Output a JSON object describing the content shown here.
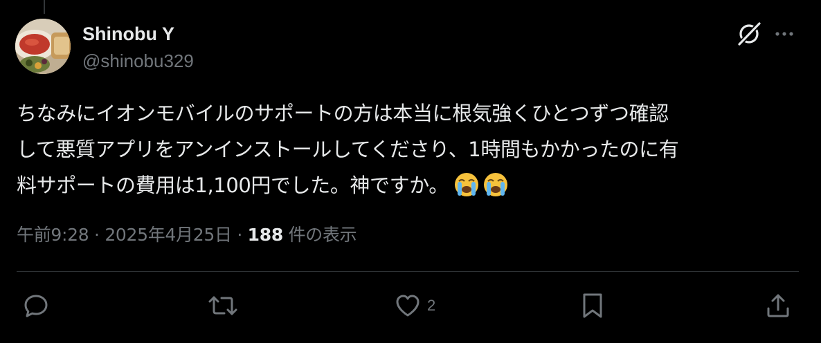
{
  "author": {
    "name": "Shinobu Y",
    "handle": "@shinobu329"
  },
  "tweet": {
    "lines": [
      "ちなみにイオンモバイルのサポートの方は本当に根気強くひとつずつ確認",
      "して悪質アプリをアンインストールしてくださり、1時間もかかったのに有",
      "料サポートの費用は1,100円でした。神ですか。"
    ],
    "emojis": [
      "loudly-crying-face",
      "loudly-crying-face"
    ]
  },
  "meta": {
    "time": "午前9:28",
    "separator": "·",
    "date": "2025年4月25日",
    "views_count": "188",
    "views_label": "件の表示"
  },
  "actions": {
    "reply_count": "",
    "repost_count": "",
    "like_count": "2",
    "bookmark_count": ""
  },
  "icons": {
    "grok": "grok-icon",
    "more": "more-icon",
    "reply": "reply-icon",
    "repost": "repost-icon",
    "like": "heart-icon",
    "bookmark": "bookmark-icon",
    "share": "share-icon"
  },
  "colors": {
    "background": "#000000",
    "primary_text": "#e7e9ea",
    "secondary_text": "#71767b",
    "divider": "#2f3336"
  }
}
